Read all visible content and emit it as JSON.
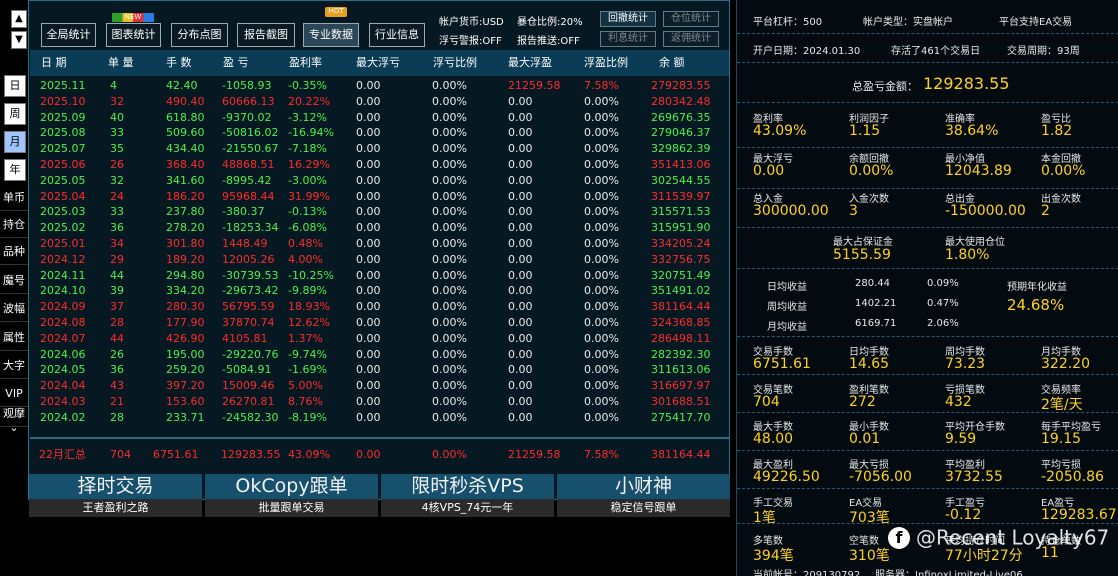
{
  "left_nav": {
    "arrow_up": "▲",
    "arrow_down": "▼",
    "period_buttons": [
      "日",
      "周",
      "月",
      "年"
    ],
    "menu_items": [
      "单币",
      "持仓",
      "品种",
      "魔号",
      "波幅",
      "属性",
      "大字",
      "VIP",
      "观摩"
    ],
    "more": "⌄"
  },
  "toolbar": {
    "buttons": [
      "全局统计",
      "图表统计",
      "分布点图",
      "报告截图",
      "专业数据",
      "行业信息"
    ],
    "new_badge": "NEW",
    "hot_badge": "HOT",
    "account_currency": "帐户货币:USD",
    "exposure_ratio": "暴仓比例:20%",
    "drawdown_alert": "浮亏警报:OFF",
    "report_push": "报告推送:OFF",
    "btn_drawdown_stats": "回撤统计",
    "btn_position_stats": "仓位统计",
    "btn_interest_stats": "利息统计",
    "btn_rebate_stats": "返佣统计"
  },
  "table": {
    "headers": [
      "日 期",
      "单 量",
      "手 数",
      "盈 亏",
      "盈利率",
      "最大浮亏",
      "浮亏比例",
      "最大浮盈",
      "浮盈比例",
      "余 额"
    ],
    "rows": [
      {
        "date": "2025.11",
        "orders": "4",
        "lots": "42.40",
        "pl": "-1058.93",
        "rate": "-0.35%",
        "maxdd": "0.00",
        "ddratio": "0.00%",
        "maxfp": "21259.58",
        "fpratio": "7.58%",
        "balance": "279283.55",
        "color": "r-mix"
      },
      {
        "date": "2025.10",
        "orders": "32",
        "lots": "490.40",
        "pl": "60666.13",
        "rate": "20.22%",
        "maxdd": "0.00",
        "ddratio": "0.00%",
        "maxfp": "0.00",
        "fpratio": "0.00%",
        "balance": "280342.48",
        "color": "r"
      },
      {
        "date": "2025.09",
        "orders": "40",
        "lots": "618.80",
        "pl": "-9370.02",
        "rate": "-3.12%",
        "maxdd": "0.00",
        "ddratio": "0.00%",
        "maxfp": "0.00",
        "fpratio": "0.00%",
        "balance": "269676.35",
        "color": "g"
      },
      {
        "date": "2025.08",
        "orders": "33",
        "lots": "509.60",
        "pl": "-50816.02",
        "rate": "-16.94%",
        "maxdd": "0.00",
        "ddratio": "0.00%",
        "maxfp": "0.00",
        "fpratio": "0.00%",
        "balance": "279046.37",
        "color": "g"
      },
      {
        "date": "2025.07",
        "orders": "35",
        "lots": "434.40",
        "pl": "-21550.67",
        "rate": "-7.18%",
        "maxdd": "0.00",
        "ddratio": "0.00%",
        "maxfp": "0.00",
        "fpratio": "0.00%",
        "balance": "329862.39",
        "color": "g"
      },
      {
        "date": "2025.06",
        "orders": "26",
        "lots": "368.40",
        "pl": "48868.51",
        "rate": "16.29%",
        "maxdd": "0.00",
        "ddratio": "0.00%",
        "maxfp": "0.00",
        "fpratio": "0.00%",
        "balance": "351413.06",
        "color": "r"
      },
      {
        "date": "2025.05",
        "orders": "32",
        "lots": "341.60",
        "pl": "-8995.42",
        "rate": "-3.00%",
        "maxdd": "0.00",
        "ddratio": "0.00%",
        "maxfp": "0.00",
        "fpratio": "0.00%",
        "balance": "302544.55",
        "color": "g"
      },
      {
        "date": "2025.04",
        "orders": "24",
        "lots": "186.20",
        "pl": "95968.44",
        "rate": "31.99%",
        "maxdd": "0.00",
        "ddratio": "0.00%",
        "maxfp": "0.00",
        "fpratio": "0.00%",
        "balance": "311539.97",
        "color": "r"
      },
      {
        "date": "2025.03",
        "orders": "33",
        "lots": "237.80",
        "pl": "-380.37",
        "rate": "-0.13%",
        "maxdd": "0.00",
        "ddratio": "0.00%",
        "maxfp": "0.00",
        "fpratio": "0.00%",
        "balance": "315571.53",
        "color": "g"
      },
      {
        "date": "2025.02",
        "orders": "36",
        "lots": "278.20",
        "pl": "-18253.34",
        "rate": "-6.08%",
        "maxdd": "0.00",
        "ddratio": "0.00%",
        "maxfp": "0.00",
        "fpratio": "0.00%",
        "balance": "315951.90",
        "color": "g"
      },
      {
        "date": "2025.01",
        "orders": "34",
        "lots": "301.80",
        "pl": "1448.49",
        "rate": "0.48%",
        "maxdd": "0.00",
        "ddratio": "0.00%",
        "maxfp": "0.00",
        "fpratio": "0.00%",
        "balance": "334205.24",
        "color": "r"
      },
      {
        "date": "2024.12",
        "orders": "29",
        "lots": "189.20",
        "pl": "12005.26",
        "rate": "4.00%",
        "maxdd": "0.00",
        "ddratio": "0.00%",
        "maxfp": "0.00",
        "fpratio": "0.00%",
        "balance": "332756.75",
        "color": "r"
      },
      {
        "date": "2024.11",
        "orders": "44",
        "lots": "294.80",
        "pl": "-30739.53",
        "rate": "-10.25%",
        "maxdd": "0.00",
        "ddratio": "0.00%",
        "maxfp": "0.00",
        "fpratio": "0.00%",
        "balance": "320751.49",
        "color": "g"
      },
      {
        "date": "2024.10",
        "orders": "39",
        "lots": "334.20",
        "pl": "-29673.42",
        "rate": "-9.89%",
        "maxdd": "0.00",
        "ddratio": "0.00%",
        "maxfp": "0.00",
        "fpratio": "0.00%",
        "balance": "351491.02",
        "color": "g"
      },
      {
        "date": "2024.09",
        "orders": "37",
        "lots": "280.30",
        "pl": "56795.59",
        "rate": "18.93%",
        "maxdd": "0.00",
        "ddratio": "0.00%",
        "maxfp": "0.00",
        "fpratio": "0.00%",
        "balance": "381164.44",
        "color": "r"
      },
      {
        "date": "2024.08",
        "orders": "28",
        "lots": "177.90",
        "pl": "37870.74",
        "rate": "12.62%",
        "maxdd": "0.00",
        "ddratio": "0.00%",
        "maxfp": "0.00",
        "fpratio": "0.00%",
        "balance": "324368.85",
        "color": "r"
      },
      {
        "date": "2024.07",
        "orders": "44",
        "lots": "426.90",
        "pl": "4105.81",
        "rate": "1.37%",
        "maxdd": "0.00",
        "ddratio": "0.00%",
        "maxfp": "0.00",
        "fpratio": "0.00%",
        "balance": "286498.11",
        "color": "r"
      },
      {
        "date": "2024.06",
        "orders": "26",
        "lots": "195.00",
        "pl": "-29220.76",
        "rate": "-9.74%",
        "maxdd": "0.00",
        "ddratio": "0.00%",
        "maxfp": "0.00",
        "fpratio": "0.00%",
        "balance": "282392.30",
        "color": "g"
      },
      {
        "date": "2024.05",
        "orders": "36",
        "lots": "259.20",
        "pl": "-5084.91",
        "rate": "-1.69%",
        "maxdd": "0.00",
        "ddratio": "0.00%",
        "maxfp": "0.00",
        "fpratio": "0.00%",
        "balance": "311613.06",
        "color": "g"
      },
      {
        "date": "2024.04",
        "orders": "43",
        "lots": "397.20",
        "pl": "15009.46",
        "rate": "5.00%",
        "maxdd": "0.00",
        "ddratio": "0.00%",
        "maxfp": "0.00",
        "fpratio": "0.00%",
        "balance": "316697.97",
        "color": "r"
      },
      {
        "date": "2024.03",
        "orders": "21",
        "lots": "153.60",
        "pl": "26270.81",
        "rate": "8.76%",
        "maxdd": "0.00",
        "ddratio": "0.00%",
        "maxfp": "0.00",
        "fpratio": "0.00%",
        "balance": "301688.51",
        "color": "r"
      },
      {
        "date": "2024.02",
        "orders": "28",
        "lots": "233.71",
        "pl": "-24582.30",
        "rate": "-8.19%",
        "maxdd": "0.00",
        "ddratio": "0.00%",
        "maxfp": "0.00",
        "fpratio": "0.00%",
        "balance": "275417.70",
        "color": "g"
      }
    ],
    "summary": {
      "date": "22月汇总",
      "orders": "704",
      "lots": "6751.61",
      "pl": "129283.55",
      "rate": "43.09%",
      "maxdd": "0.00",
      "ddratio": "0.00%",
      "maxfp": "21259.58",
      "fpratio": "7.58%",
      "balance": "381164.44"
    }
  },
  "ads": [
    {
      "title": "择时交易",
      "subtitle": "王者盈利之路"
    },
    {
      "title": "OkCopy跟单",
      "subtitle": "批量跟单交易"
    },
    {
      "title": "限时秒杀VPS",
      "subtitle": "4核VPS_74元一年"
    },
    {
      "title": "小财神",
      "subtitle": "稳定信号跟单"
    }
  ],
  "stats": {
    "leverage": "平台杠杆：500",
    "account_type": "帐户类型：实盘帐户",
    "ea_support": "平台支持EA交易",
    "open_date": "开户日期：2024.01.30",
    "survival": "存活了461个交易日",
    "cycle": "交易周期：93周",
    "total_pl_label": "总盈亏金额：",
    "total_pl": "129283.55",
    "grid1": [
      {
        "label": "盈利率",
        "value": "43.09%"
      },
      {
        "label": "利润因子",
        "value": "1.15"
      },
      {
        "label": "准确率",
        "value": "38.64%"
      },
      {
        "label": "盈亏比",
        "value": "1.82"
      },
      {
        "label": "最大浮亏",
        "value": "0.00"
      },
      {
        "label": "余额回撤",
        "value": "0.00%"
      },
      {
        "label": "最小净值",
        "value": "12043.89"
      },
      {
        "label": "本金回撤",
        "value": "0.00%"
      },
      {
        "label": "总入金",
        "value": "300000.00"
      },
      {
        "label": "入金次数",
        "value": "3"
      },
      {
        "label": "总出金",
        "value": "-150000.00"
      },
      {
        "label": "出金次数",
        "value": "2"
      }
    ],
    "margin": [
      {
        "label": "最大占保证金",
        "value": "5155.59"
      },
      {
        "label": "最大使用仓位",
        "value": "1.80%"
      }
    ],
    "daily_avg": {
      "label": "日均收益",
      "value": "280.44",
      "pct": "0.09%"
    },
    "weekly_avg": {
      "label": "周均收益",
      "value": "1402.21",
      "pct": "0.47%"
    },
    "monthly_avg": {
      "label": "月均收益",
      "value": "6169.71",
      "pct": "2.06%"
    },
    "annual_label": "预期年化收益",
    "annual_value": "24.68%",
    "grid2": [
      {
        "label": "交易手数",
        "value": "6751.61"
      },
      {
        "label": "日均手数",
        "value": "14.65"
      },
      {
        "label": "周均手数",
        "value": "73.23"
      },
      {
        "label": "月均手数",
        "value": "322.20"
      },
      {
        "label": "交易笔数",
        "value": "704"
      },
      {
        "label": "盈利笔数",
        "value": "272"
      },
      {
        "label": "亏损笔数",
        "value": "432"
      },
      {
        "label": "交易频率",
        "value": "2笔/天"
      }
    ],
    "grid3": [
      {
        "label": "最大手数",
        "value": "48.00"
      },
      {
        "label": "最小手数",
        "value": "0.01"
      },
      {
        "label": "平均开仓手数",
        "value": "9.59"
      },
      {
        "label": "每手平均盈亏",
        "value": "19.15"
      },
      {
        "label": "最大盈利",
        "value": "49226.50"
      },
      {
        "label": "最大亏损",
        "value": "-7056.00"
      },
      {
        "label": "平均盈利",
        "value": "3732.55"
      },
      {
        "label": "平均亏损",
        "value": "-2050.86"
      },
      {
        "label": "手工交易",
        "value": "1笔"
      },
      {
        "label": "EA交易",
        "value": "703笔"
      },
      {
        "label": "手工盈亏",
        "value": "-0.12"
      },
      {
        "label": "EA盈亏",
        "value": "129283.67"
      },
      {
        "label": "多笔数",
        "value": "394笔"
      },
      {
        "label": "空笔数",
        "value": "310笔"
      },
      {
        "label": "平均持仓时间",
        "value": "77小时27分"
      },
      {
        "label": "持仓单数",
        "value": "11"
      }
    ],
    "account_no": "当前帐号：209130792",
    "server": "服务器：InfinoxLimited-Live06"
  },
  "watermark": {
    "icon": "f",
    "text": "@Recent Loyalty67"
  }
}
